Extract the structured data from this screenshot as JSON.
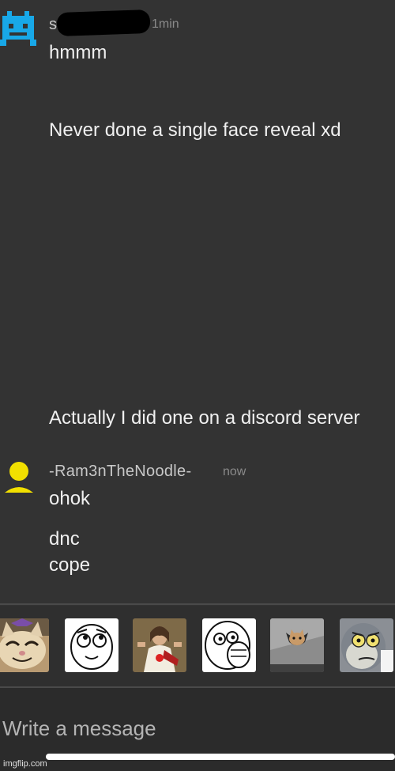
{
  "messages": [
    {
      "username": "s",
      "time": "1min",
      "lines": [
        "hmmm",
        "Never done a single face reveal xd",
        "Actually I did one on a discord server"
      ]
    },
    {
      "username": "-Ram3nTheNoodle-",
      "time": "now",
      "lines": [
        "ohok",
        "dnc",
        "cope"
      ]
    }
  ],
  "stickers": [
    {
      "name": "happy-cat-sticker"
    },
    {
      "name": "derp-face-sticker"
    },
    {
      "name": "buddy-christ-sticker"
    },
    {
      "name": "lol-face-sticker"
    },
    {
      "name": "ceiling-cat-sticker"
    },
    {
      "name": "unsettled-tom-sticker"
    }
  ],
  "composer": {
    "placeholder": "Write a message"
  },
  "watermark": "imgflip.com",
  "colors": {
    "background": "#333333",
    "avatar_blue": "#18a8e8",
    "avatar_yellow": "#f2e000"
  }
}
